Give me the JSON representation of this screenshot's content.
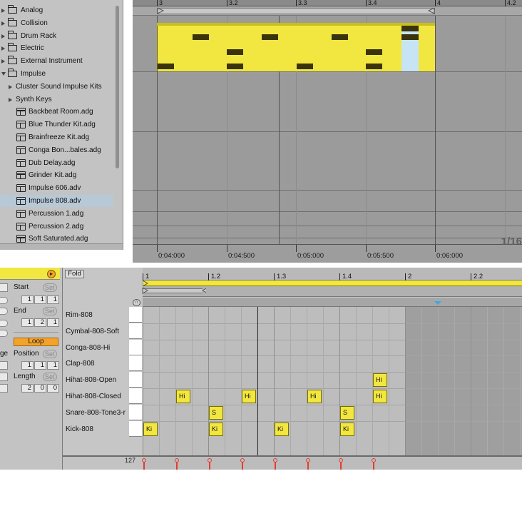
{
  "browser": {
    "items": [
      {
        "label": "Analog",
        "kind": "folder",
        "expanded": false
      },
      {
        "label": "Collision",
        "kind": "folder",
        "expanded": false
      },
      {
        "label": "Drum Rack",
        "kind": "folder",
        "expanded": false
      },
      {
        "label": "Electric",
        "kind": "folder",
        "expanded": false
      },
      {
        "label": "External Instrument",
        "kind": "folder",
        "expanded": false
      },
      {
        "label": "Impulse",
        "kind": "folder",
        "expanded": true
      },
      {
        "label": "Cluster Sound Impulse Kits",
        "kind": "subfolder"
      },
      {
        "label": "Synth Keys",
        "kind": "subfolder"
      },
      {
        "label": "Backbeat Room.adg",
        "kind": "preset"
      },
      {
        "label": "Blue Thunder Kit.adg",
        "kind": "preset"
      },
      {
        "label": "Brainfreeze Kit.adg",
        "kind": "preset"
      },
      {
        "label": "Conga Bon...bales.adg",
        "kind": "preset"
      },
      {
        "label": "Dub Delay.adg",
        "kind": "preset"
      },
      {
        "label": "Grinder Kit.adg",
        "kind": "preset"
      },
      {
        "label": "Impulse 606.adv",
        "kind": "preset"
      },
      {
        "label": "Impulse 808.adv",
        "kind": "preset",
        "selected": true
      },
      {
        "label": "Percussion 1.adg",
        "kind": "preset"
      },
      {
        "label": "Percussion 2.adg",
        "kind": "preset"
      },
      {
        "label": "Soft Saturated.adg",
        "kind": "preset"
      }
    ]
  },
  "arrangement": {
    "ruler": [
      "3",
      "3.2",
      "3.3",
      "3.4",
      "4",
      "4.2"
    ],
    "time_labels": [
      "0:04:000",
      "0:04:500",
      "0:05:000",
      "0:05:500",
      "0:06:000"
    ],
    "zoom": "1/16"
  },
  "clip_panel": {
    "launch_icon": "play-circle-icon",
    "start_label": "Start",
    "set_label": "Set",
    "start_values": [
      "1",
      "1",
      "1"
    ],
    "end_label": "End",
    "end_values": [
      "1",
      "2",
      "1"
    ],
    "loop_label": "Loop",
    "position_label": "Position",
    "position_values": [
      "1",
      "1",
      "1"
    ],
    "length_label": "Length",
    "length_values": [
      "2",
      "0",
      "0"
    ],
    "partial_label": "ge"
  },
  "piano_roll": {
    "fold_label": "Fold",
    "ruler": [
      "1",
      "1.2",
      "1.3",
      "1.4",
      "2",
      "2.2"
    ],
    "lanes": [
      "Rim-808",
      "Cymbal-808-Soft",
      "Conga-808-Hi",
      "Clap-808",
      "Hihat-808-Open",
      "Hihat-808-Closed",
      "Snare-808-Tone3-r",
      "Kick-808"
    ],
    "notes": [
      {
        "lane": 7,
        "step": 0,
        "label": "Ki"
      },
      {
        "lane": 5,
        "step": 1,
        "label": "Hi"
      },
      {
        "lane": 6,
        "step": 2,
        "label": "S"
      },
      {
        "lane": 7,
        "step": 2,
        "label": "Ki"
      },
      {
        "lane": 5,
        "step": 3,
        "label": "Hi"
      },
      {
        "lane": 7,
        "step": 4,
        "label": "Ki"
      },
      {
        "lane": 5,
        "step": 5,
        "label": "Hi"
      },
      {
        "lane": 6,
        "step": 6,
        "label": "S"
      },
      {
        "lane": 7,
        "step": 6,
        "label": "Ki"
      },
      {
        "lane": 4,
        "step": 7,
        "label": "Hi"
      },
      {
        "lane": 5,
        "step": 7,
        "label": "Hi"
      }
    ],
    "velocity_max": "127"
  },
  "colors": {
    "clip_yellow": "#f2e640",
    "selection_blue": "#b7c9d7",
    "loop_orange": "#f3a32c",
    "velocity_red": "#e33d2d"
  }
}
